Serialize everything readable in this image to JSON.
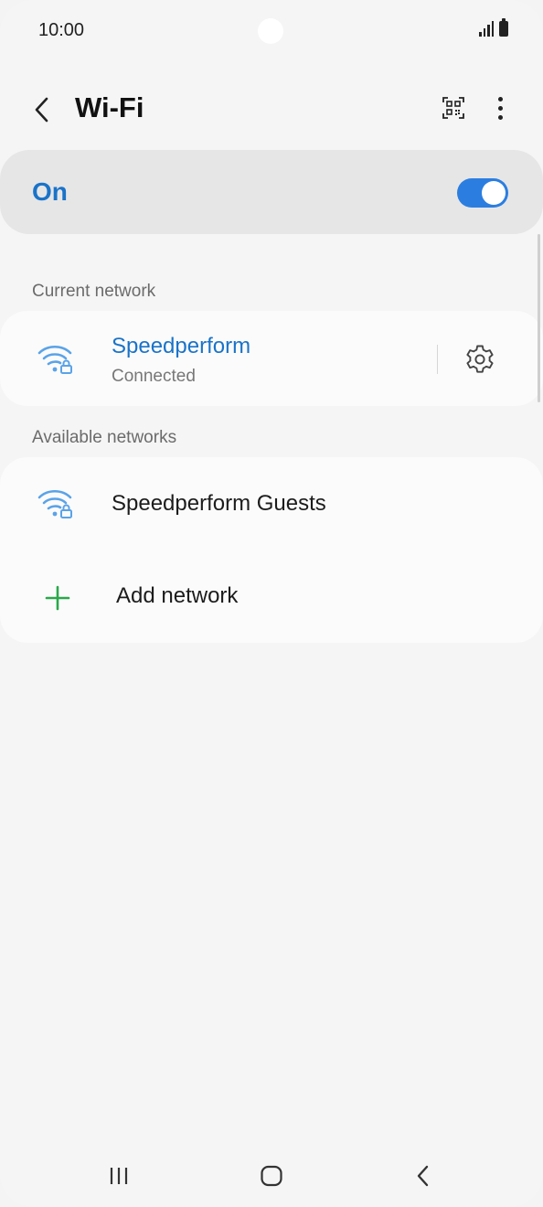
{
  "status_bar": {
    "time": "10:00"
  },
  "header": {
    "title": "Wi-Fi",
    "back_icon": "chevron-left-icon",
    "qr_icon": "qr-code-scan-icon",
    "more_icon": "more-vertical-icon"
  },
  "wifi_toggle": {
    "label": "On",
    "state": true
  },
  "current_network": {
    "section_label": "Current network",
    "name": "Speedperform",
    "status": "Connected",
    "icon": "wifi-lock-icon",
    "settings_icon": "gear-icon"
  },
  "available_networks": {
    "section_label": "Available networks",
    "items": [
      {
        "name": "Speedperform Guests",
        "icon": "wifi-lock-icon"
      }
    ],
    "add_label": "Add network",
    "add_icon": "plus-icon"
  },
  "navigation": {
    "recents_icon": "recents-icon",
    "home_icon": "home-icon",
    "back_icon": "back-icon"
  },
  "colors": {
    "accent": "#1a73c8",
    "toggle": "#2b7ee0",
    "wifi_icon": "#5aa3e8",
    "add_icon": "#2aa84a",
    "background": "#f5f5f5"
  }
}
